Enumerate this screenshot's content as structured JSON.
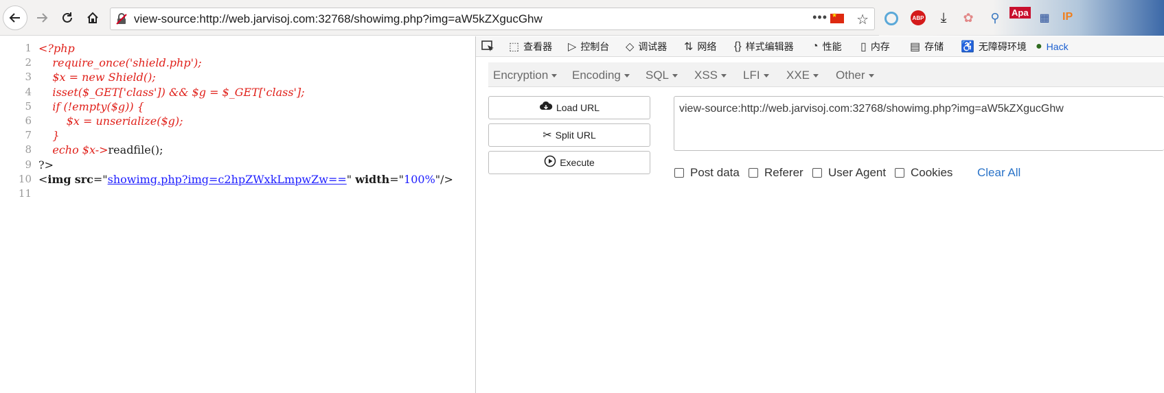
{
  "browser": {
    "url": "view-source:http://web.jarvisoj.com:32768/showimg.php?img=aW5kZXgucGhw",
    "url_menu": "•••",
    "extensions": {
      "apa_label": "Apa",
      "ip_label": "IP",
      "abp_label": "ABP"
    }
  },
  "source": {
    "lines": [
      {
        "num": "1",
        "parts": [
          {
            "cls": "php",
            "text": "<?php"
          }
        ]
      },
      {
        "num": "2",
        "parts": [
          {
            "cls": "php",
            "text": "    require_once('shield.php');"
          }
        ]
      },
      {
        "num": "3",
        "parts": [
          {
            "cls": "php",
            "text": "    $x = new Shield();"
          }
        ]
      },
      {
        "num": "4",
        "parts": [
          {
            "cls": "php",
            "text": "    isset($_GET['class']) && $g = $_GET['class'];"
          }
        ]
      },
      {
        "num": "5",
        "parts": [
          {
            "cls": "php",
            "text": "    if (!empty($g)) {"
          }
        ]
      },
      {
        "num": "6",
        "parts": [
          {
            "cls": "php",
            "text": "        $x = unserialize($g);"
          }
        ]
      },
      {
        "num": "7",
        "parts": [
          {
            "cls": "php",
            "text": "    }"
          }
        ]
      },
      {
        "num": "8",
        "parts": [
          {
            "cls": "php",
            "text": "    echo $x->"
          },
          {
            "cls": "plain",
            "text": "readfile();"
          }
        ]
      },
      {
        "num": "9",
        "parts": [
          {
            "cls": "plain",
            "text": "?>"
          }
        ]
      },
      {
        "num": "10",
        "parts": [
          {
            "cls": "tag",
            "text": "<"
          },
          {
            "cls": "attr",
            "text": "img"
          },
          {
            "cls": "tag",
            "text": " "
          },
          {
            "cls": "attr",
            "text": "src"
          },
          {
            "cls": "tag",
            "text": "=\""
          },
          {
            "cls": "lnk",
            "text": "showimg.php?img=c2hpZWxkLmpwZw=="
          },
          {
            "cls": "tag",
            "text": "\" "
          },
          {
            "cls": "attr",
            "text": "width"
          },
          {
            "cls": "tag",
            "text": "=\""
          },
          {
            "cls": "val",
            "text": "100%"
          },
          {
            "cls": "tag",
            "text": "\"/>"
          }
        ]
      },
      {
        "num": "11",
        "parts": []
      }
    ]
  },
  "devtools": {
    "tabs": [
      {
        "icon": "⬚",
        "label": "查看器"
      },
      {
        "icon": "▷",
        "label": "控制台"
      },
      {
        "icon": "◇",
        "label": "调试器"
      },
      {
        "icon": "⇅",
        "label": "网络"
      },
      {
        "icon": "{}",
        "label": "样式编辑器"
      },
      {
        "icon": "◔",
        "label": "性能"
      },
      {
        "icon": "▯",
        "label": "内存"
      },
      {
        "icon": "▤",
        "label": "存储"
      },
      {
        "icon": "♿",
        "label": "无障碍环境"
      },
      {
        "icon": "●",
        "label": "Hack"
      }
    ]
  },
  "hackbar": {
    "menu": [
      "Encryption",
      "Encoding",
      "SQL",
      "XSS",
      "LFI",
      "XXE",
      "Other"
    ],
    "buttons": {
      "load": "Load URL",
      "split": "Split URL",
      "execute": "Execute"
    },
    "url_value": "view-source:http://web.jarvisoj.com:32768/showimg.php?img=aW5kZXgucGhw",
    "checkboxes": [
      "Post data",
      "Referer",
      "User Agent",
      "Cookies"
    ],
    "clear_all": "Clear All"
  },
  "colors": {
    "php_code": "#e0201a",
    "link": "#1c1cff",
    "clear_all": "#2a73c8"
  }
}
